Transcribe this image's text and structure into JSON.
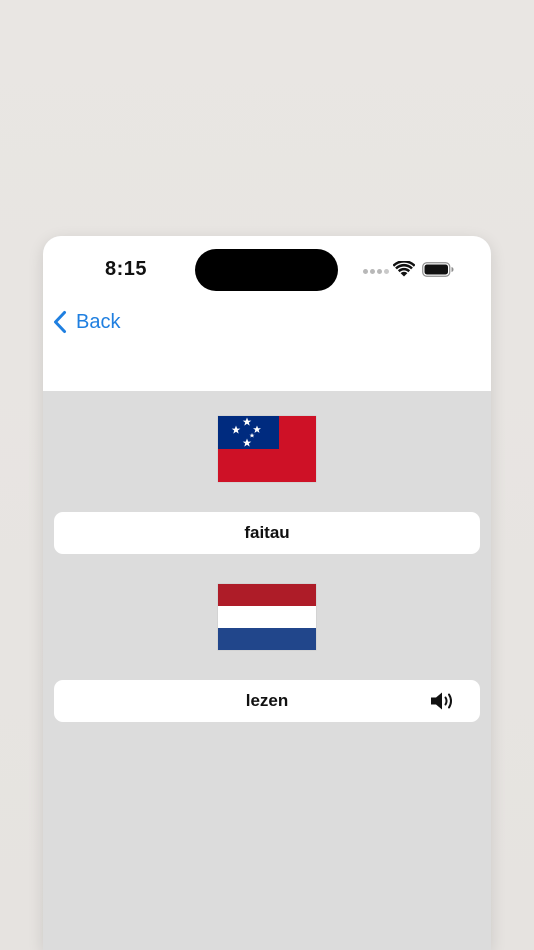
{
  "status_bar": {
    "time": "8:15",
    "icons": [
      "signal-dots-icon",
      "wifi-icon",
      "battery-icon"
    ]
  },
  "nav": {
    "back_label": "Back",
    "back_icon": "chevron-left-icon",
    "accent_color": "#1f7fe0"
  },
  "source": {
    "flag": "samoa-flag-icon",
    "word": "faitau"
  },
  "target": {
    "flag": "netherlands-flag-icon",
    "word": "lezen",
    "audio_icon": "speaker-icon"
  },
  "colors": {
    "content_background": "#dcdcdc",
    "card_background": "#ffffff",
    "samoa_red": "#ce1126",
    "samoa_blue": "#002b7f",
    "nl_red": "#ae1c28",
    "nl_blue": "#21468b"
  }
}
